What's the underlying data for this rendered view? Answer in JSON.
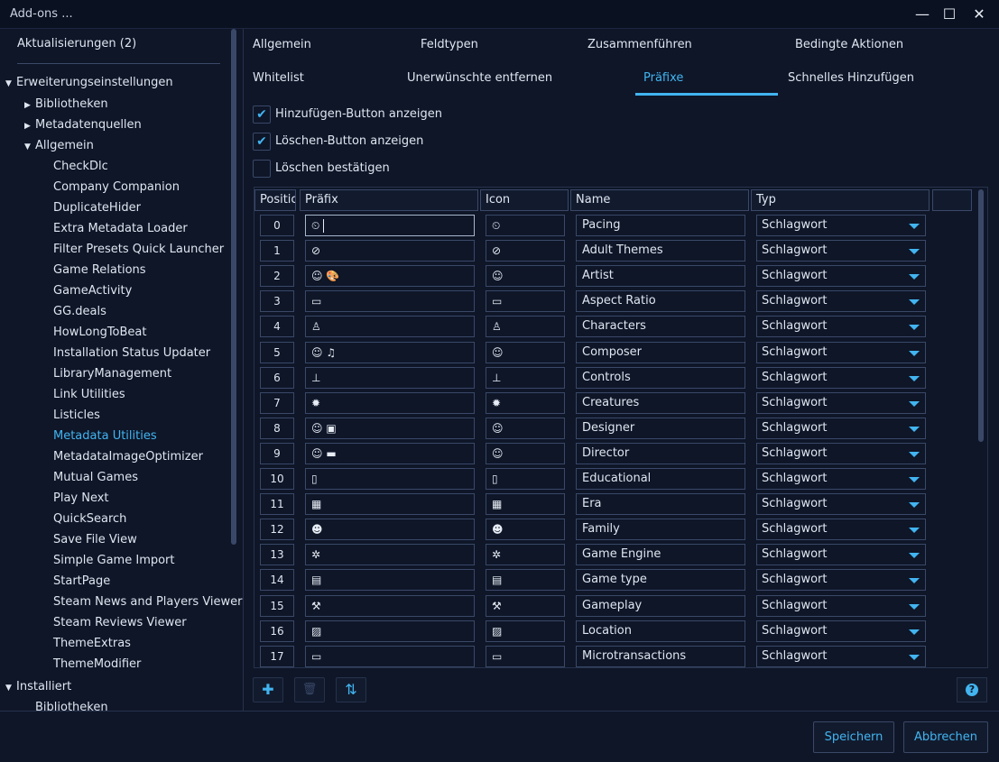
{
  "window": {
    "title": "Add-ons ...",
    "minimize": "—",
    "maximize": "☐",
    "close": "✕"
  },
  "sidebar": {
    "updates": "Aktualisierungen (2)",
    "extension_settings": "Erweiterungseinstellungen",
    "libraries": "Bibliotheken",
    "metadata_sources": "Metadatenquellen",
    "general": "Allgemein",
    "general_items": [
      "CheckDlc",
      "Company Companion",
      "DuplicateHider",
      "Extra Metadata Loader",
      "Filter Presets Quick Launcher",
      "Game Relations",
      "GameActivity",
      "GG.deals",
      "HowLongToBeat",
      "Installation Status Updater",
      "LibraryManagement",
      "Link Utilities",
      "Listicles",
      "Metadata Utilities",
      "MetadataImageOptimizer",
      "Mutual Games",
      "Play Next",
      "QuickSearch",
      "Save File View",
      "Simple Game Import",
      "StartPage",
      "Steam News and Players Viewer",
      "Steam Reviews Viewer",
      "ThemeExtras",
      "ThemeModifier"
    ],
    "active_item": "Metadata Utilities",
    "installed": "Installiert",
    "installed_libraries": "Bibliotheken"
  },
  "tabs": {
    "row1": [
      "Allgemein",
      "Feldtypen",
      "Zusammenführen",
      "Bedingte Aktionen"
    ],
    "row2": [
      "Whitelist",
      "Unerwünschte entfernen",
      "Präfixe",
      "Schnelles Hinzufügen"
    ],
    "active": "Präfixe"
  },
  "checkboxes": [
    {
      "label": "Hinzufügen-Button anzeigen",
      "checked": true
    },
    {
      "label": "Löschen-Button anzeigen",
      "checked": true
    },
    {
      "label": "Löschen bestätigen",
      "checked": false
    }
  ],
  "grid": {
    "headers": [
      "Positic",
      "Präfix",
      "Icon",
      "Name",
      "Typ"
    ],
    "rows": [
      {
        "pos": "0",
        "prefix": "⏲",
        "icon": "⏲",
        "name": "Pacing",
        "type": "Schlagwort"
      },
      {
        "pos": "1",
        "prefix": "⊘",
        "icon": "⊘",
        "name": "Adult Themes",
        "type": "Schlagwort"
      },
      {
        "pos": "2",
        "prefix": "☺ 🎨",
        "icon": "☺",
        "name": "Artist",
        "type": "Schlagwort"
      },
      {
        "pos": "3",
        "prefix": "▭",
        "icon": "▭",
        "name": "Aspect Ratio",
        "type": "Schlagwort"
      },
      {
        "pos": "4",
        "prefix": "♙",
        "icon": "♙",
        "name": "Characters",
        "type": "Schlagwort"
      },
      {
        "pos": "5",
        "prefix": "☺ ♫",
        "icon": "☺",
        "name": "Composer",
        "type": "Schlagwort"
      },
      {
        "pos": "6",
        "prefix": "⊥",
        "icon": "⊥",
        "name": "Controls",
        "type": "Schlagwort"
      },
      {
        "pos": "7",
        "prefix": "✹",
        "icon": "✹",
        "name": "Creatures",
        "type": "Schlagwort"
      },
      {
        "pos": "8",
        "prefix": "☺ ▣",
        "icon": "☺",
        "name": "Designer",
        "type": "Schlagwort"
      },
      {
        "pos": "9",
        "prefix": "☺ ▬",
        "icon": "☺",
        "name": "Director",
        "type": "Schlagwort"
      },
      {
        "pos": "10",
        "prefix": "▯",
        "icon": "▯",
        "name": "Educational",
        "type": "Schlagwort"
      },
      {
        "pos": "11",
        "prefix": "▦",
        "icon": "▦",
        "name": "Era",
        "type": "Schlagwort"
      },
      {
        "pos": "12",
        "prefix": "☻",
        "icon": "☻",
        "name": "Family",
        "type": "Schlagwort"
      },
      {
        "pos": "13",
        "prefix": "✲",
        "icon": "✲",
        "name": "Game Engine",
        "type": "Schlagwort"
      },
      {
        "pos": "14",
        "prefix": "▤",
        "icon": "▤",
        "name": "Game type",
        "type": "Schlagwort"
      },
      {
        "pos": "15",
        "prefix": "⚒",
        "icon": "⚒",
        "name": "Gameplay",
        "type": "Schlagwort"
      },
      {
        "pos": "16",
        "prefix": "▨",
        "icon": "▨",
        "name": "Location",
        "type": "Schlagwort"
      },
      {
        "pos": "17",
        "prefix": "▭",
        "icon": "▭",
        "name": "Microtransactions",
        "type": "Schlagwort"
      }
    ]
  },
  "toolbar": {
    "add_icon": "add-icon",
    "delete_icon": "trash-icon",
    "sort_icon": "sort-icon",
    "add_glyph": "✚",
    "delete_glyph": "🗑",
    "sort_glyph": "⇅",
    "help_glyph": "?"
  },
  "footer": {
    "save": "Speichern",
    "cancel": "Abbrechen"
  },
  "colors": {
    "accent": "#42b4f0",
    "background": "#0e1628",
    "border": "#3a4868"
  }
}
